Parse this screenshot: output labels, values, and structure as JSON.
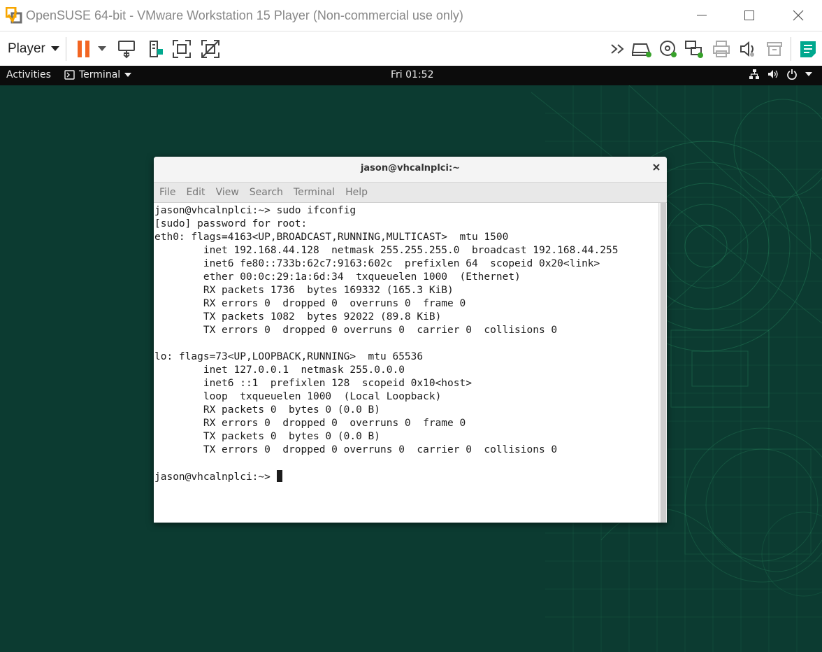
{
  "window": {
    "title": "OpenSUSE 64-bit - VMware Workstation 15 Player (Non-commercial use only)"
  },
  "toolbar": {
    "player_label": "Player"
  },
  "gnome": {
    "activities": "Activities",
    "app_menu": "Terminal",
    "clock": "Fri 01:52"
  },
  "terminal": {
    "title": "jason@vhcalnplci:~",
    "menu": [
      "File",
      "Edit",
      "View",
      "Search",
      "Terminal",
      "Help"
    ],
    "lines": [
      "jason@vhcalnplci:~> sudo ifconfig",
      "[sudo] password for root:",
      "eth0: flags=4163<UP,BROADCAST,RUNNING,MULTICAST>  mtu 1500",
      "        inet 192.168.44.128  netmask 255.255.255.0  broadcast 192.168.44.255",
      "        inet6 fe80::733b:62c7:9163:602c  prefixlen 64  scopeid 0x20<link>",
      "        ether 00:0c:29:1a:6d:34  txqueuelen 1000  (Ethernet)",
      "        RX packets 1736  bytes 169332 (165.3 KiB)",
      "        RX errors 0  dropped 0  overruns 0  frame 0",
      "        TX packets 1082  bytes 92022 (89.8 KiB)",
      "        TX errors 0  dropped 0 overruns 0  carrier 0  collisions 0",
      "",
      "lo: flags=73<UP,LOOPBACK,RUNNING>  mtu 65536",
      "        inet 127.0.0.1  netmask 255.0.0.0",
      "        inet6 ::1  prefixlen 128  scopeid 0x10<host>",
      "        loop  txqueuelen 1000  (Local Loopback)",
      "        RX packets 0  bytes 0 (0.0 B)",
      "        RX errors 0  dropped 0  overruns 0  frame 0",
      "        TX packets 0  bytes 0 (0.0 B)",
      "        TX errors 0  dropped 0 overruns 0  carrier 0  collisions 0",
      ""
    ],
    "prompt": "jason@vhcalnplci:~> "
  },
  "colors": {
    "desktop_bg": "#0c3b31",
    "pattern": "#2f9a6a",
    "pause_orange": "#f26522",
    "status_green": "#37a12a",
    "toolbar_accent": "#00a88e"
  },
  "icons": {
    "app_logo": "vmware-logo-icon",
    "pause": "pause-icon",
    "send_ctrl_alt_del": "send-ctrl-alt-del-icon",
    "removable_devices": "removable-devices-icon",
    "fullscreen": "full-screen-icon",
    "unity": "unity-mode-icon",
    "more": "more-devices-icon"
  }
}
